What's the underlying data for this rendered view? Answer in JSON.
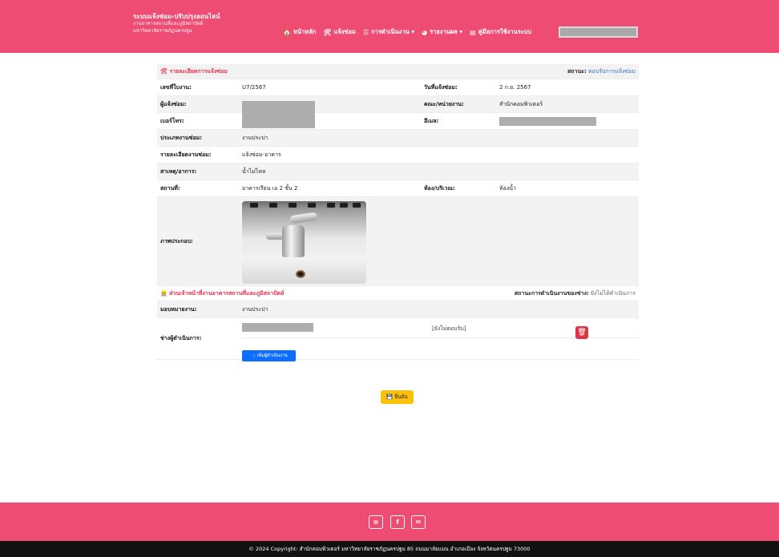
{
  "brand": {
    "line1": "ระบบแจ้งซ่อม-ปรับปรุงออนไลน์",
    "line2": "งานอาคารสถานที่และภูมิสถาปัตย์",
    "line3": "มหาวิทยาลัยราชภัฏนครปฐม"
  },
  "nav": {
    "items": [
      {
        "label": "หน้าหลัก",
        "icon": "home-icon",
        "glyph": "🏠"
      },
      {
        "label": "แจ้งซ่อม",
        "icon": "tools-icon",
        "glyph": "🛠"
      },
      {
        "label": "การดำเนินงาน ▾",
        "icon": "list-icon",
        "glyph": "☰"
      },
      {
        "label": "รายงานผล ▾",
        "icon": "pie-chart-icon",
        "glyph": "◕"
      },
      {
        "label": "คู่มือการใช้งานระบบ",
        "icon": "book-icon",
        "glyph": "▤"
      }
    ]
  },
  "details": {
    "title": "รายละเอียดการแจ้งซ่อม",
    "status_label": "สถานะ:",
    "status_value": "ตอบรับการแจ้งซ่อม",
    "job_no_label": "เลขที่ใบงาน:",
    "job_no": "U7/2567",
    "date_label": "วันที่แจ้งซ่อม:",
    "date": "2 ก.ย. 2567",
    "requester_label": "ผู้แจ้งซ่อม:",
    "faculty_label": "คณะ/หน่วยงาน:",
    "faculty": "สำนักคอมพิวเตอร์",
    "phone_label": "เบอร์โทร:",
    "email_label": "อีเมล:",
    "type_label": "ประเภทงานซ่อม:",
    "type": "งานประปา",
    "detail_label": "รายละเอียดงานซ่อม:",
    "detail": "แจ้งซ่อม-อาคาร",
    "cause_label": "สาเหตุ/อาการ:",
    "cause": "น้ำไม่ไหล",
    "place_label": "สถานที่:",
    "place": "อาคารเรียน เอ 2 ชั้น 2",
    "room_label": "ห้อง/บริเวณ:",
    "room": "ห้องน้ำ",
    "image_label": "ภาพประกอบ:"
  },
  "staff": {
    "title": "ส่วนเจ้าหน้าที่งานอาคารสถานที่และภูมิสถาปัตย์",
    "status_label": "สถานะการดำเนินงานของช่าง:",
    "status_value": "ยังไม่ได้ดำเนินการ",
    "assign_label": "มอบหมายงาน:",
    "assign_value": "งานประปา",
    "tech_label": "ช่างผู้ดำเนินการ:",
    "tech_status": "[ยังไม่ตอบรับ]",
    "add_button": "เพิ่มผู้ดำเนินงาน"
  },
  "actions": {
    "confirm": "ยืนยัน"
  },
  "footer": {
    "copyright": "© 2024 Copyright: สำนักคอมพิวเตอร์ มหาวิทยาลัยราชภัฏนครปฐม 85 ถนนมาลัยแมน อำเภอเมือง จังหวัดนครปฐม 73000",
    "icons": [
      "globe-icon",
      "facebook-icon",
      "mail-icon"
    ]
  },
  "colors": {
    "brand": "#ef4c73",
    "danger": "#dc3545",
    "primary": "#0d6efd",
    "warning": "#ffc107"
  }
}
